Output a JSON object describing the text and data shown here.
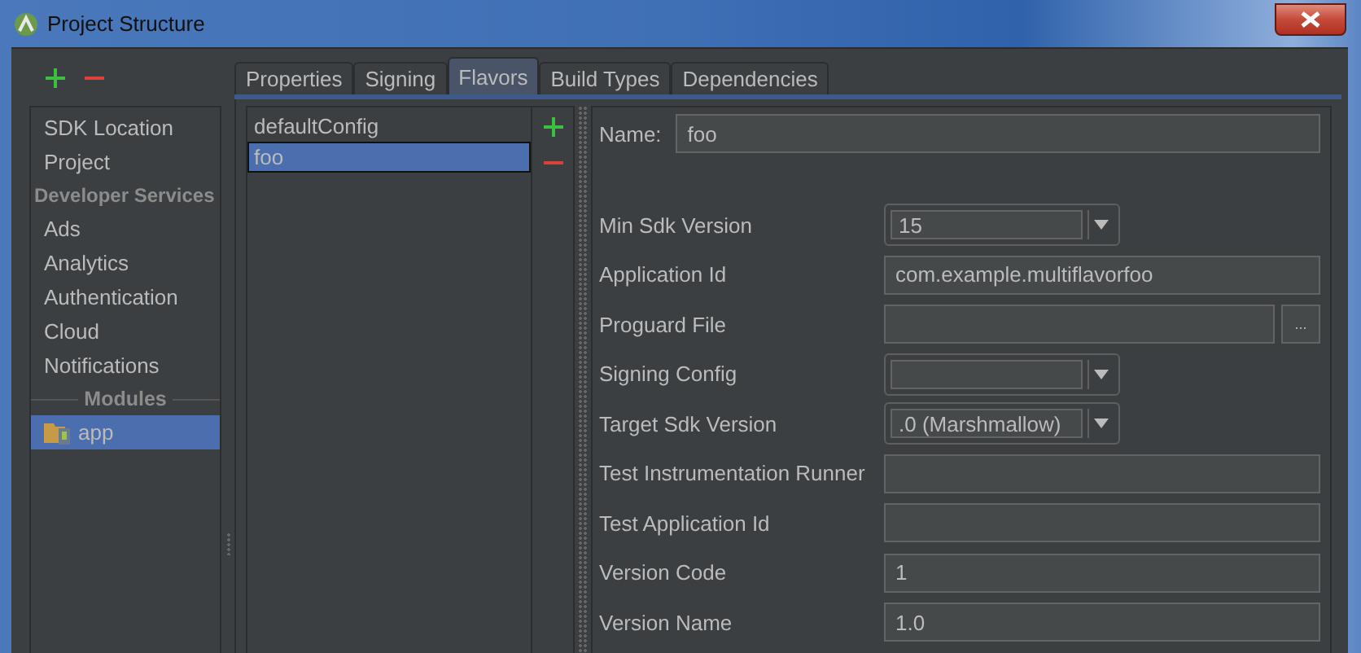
{
  "window": {
    "title": "Project Structure"
  },
  "sidebar": {
    "items": [
      {
        "kind": "item",
        "label": "SDK Location",
        "selected": false
      },
      {
        "kind": "item",
        "label": "Project",
        "selected": false
      },
      {
        "kind": "header",
        "label": "Developer Services"
      },
      {
        "kind": "item",
        "label": "Ads",
        "selected": false
      },
      {
        "kind": "item",
        "label": "Analytics",
        "selected": false
      },
      {
        "kind": "item",
        "label": "Authentication",
        "selected": false
      },
      {
        "kind": "item",
        "label": "Cloud",
        "selected": false
      },
      {
        "kind": "item",
        "label": "Notifications",
        "selected": false
      },
      {
        "kind": "divider",
        "label": "Modules"
      },
      {
        "kind": "module",
        "label": "app",
        "selected": true
      }
    ]
  },
  "tabs": [
    {
      "label": "Properties",
      "selected": false
    },
    {
      "label": "Signing",
      "selected": false
    },
    {
      "label": "Flavors",
      "selected": true
    },
    {
      "label": "Build Types",
      "selected": false
    },
    {
      "label": "Dependencies",
      "selected": false
    }
  ],
  "flavors": [
    {
      "label": "defaultConfig",
      "selected": false
    },
    {
      "label": "foo",
      "selected": true
    }
  ],
  "name": {
    "label": "Name:",
    "value": "foo"
  },
  "fields": [
    {
      "kind": "combo",
      "label": "Min Sdk Version",
      "value": "15"
    },
    {
      "kind": "text",
      "label": "Application Id",
      "value": "com.example.multiflavorfoo"
    },
    {
      "kind": "file",
      "label": "Proguard File",
      "button": "..."
    },
    {
      "kind": "combo",
      "label": "Signing Config"
    },
    {
      "kind": "combo",
      "label": "Target Sdk Version",
      "value": ".0 (Marshmallow)"
    },
    {
      "kind": "text",
      "label": "Test Instrumentation Runner"
    },
    {
      "kind": "text",
      "label": "Test Application Id"
    },
    {
      "kind": "text",
      "label": "Version Code",
      "value": "1"
    },
    {
      "kind": "text",
      "label": "Version Name",
      "value": "1.0"
    }
  ]
}
